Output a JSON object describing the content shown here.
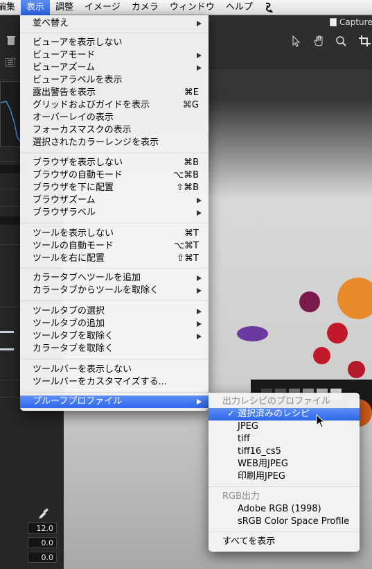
{
  "menubar": {
    "items": [
      "編集",
      "表示",
      "調整",
      "イメージ",
      "カメラ",
      "ウィンドウ",
      "ヘルプ"
    ],
    "active_index": 1
  },
  "window": {
    "title": "Capture"
  },
  "left_panel": {
    "values": [
      "12.0",
      "0.0",
      "0.0"
    ]
  },
  "view_menu": {
    "items": [
      {
        "label": "並べ替え",
        "shortcut": "",
        "submenu": true
      },
      {
        "label": "ビューアを表示しない",
        "shortcut": "",
        "submenu": false
      },
      {
        "label": "ビューアモード",
        "shortcut": "",
        "submenu": true
      },
      {
        "label": "ビューアズーム",
        "shortcut": "",
        "submenu": true
      },
      {
        "label": "ビューアラベルを表示",
        "shortcut": "",
        "submenu": false
      },
      {
        "label": "露出警告を表示",
        "shortcut": "⌘E",
        "submenu": false
      },
      {
        "label": "グリッドおよびガイドを表示",
        "shortcut": "⌘G",
        "submenu": false
      },
      {
        "label": "オーバーレイの表示",
        "shortcut": "",
        "submenu": false
      },
      {
        "label": "フォーカスマスクの表示",
        "shortcut": "",
        "submenu": false
      },
      {
        "label": "選択されたカラーレンジを表示",
        "shortcut": "",
        "submenu": false
      },
      {
        "label": "ブラウザを表示しない",
        "shortcut": "⌘B",
        "submenu": false
      },
      {
        "label": "ブラウザの自動モード",
        "shortcut": "⌥⌘B",
        "submenu": false
      },
      {
        "label": "ブラウザを下に配置",
        "shortcut": "⇧⌘B",
        "submenu": false
      },
      {
        "label": "ブラウザズーム",
        "shortcut": "",
        "submenu": true
      },
      {
        "label": "ブラウザラベル",
        "shortcut": "",
        "submenu": true
      },
      {
        "label": "ツールを表示しない",
        "shortcut": "⌘T",
        "submenu": false
      },
      {
        "label": "ツールの自動モード",
        "shortcut": "⌥⌘T",
        "submenu": false
      },
      {
        "label": "ツールを右に配置",
        "shortcut": "⇧⌘T",
        "submenu": false
      },
      {
        "label": "カラータブへツールを追加",
        "shortcut": "",
        "submenu": true
      },
      {
        "label": "カラータブからツールを取除く",
        "shortcut": "",
        "submenu": true
      },
      {
        "label": "ツールタブの選択",
        "shortcut": "",
        "submenu": true
      },
      {
        "label": "ツールタブの追加",
        "shortcut": "",
        "submenu": true
      },
      {
        "label": "ツールタブを取除く",
        "shortcut": "",
        "submenu": true
      },
      {
        "label": "カラータブを取除く",
        "shortcut": "",
        "submenu": false
      },
      {
        "label": "ツールバーを表示しない",
        "shortcut": "",
        "submenu": false
      },
      {
        "label": "ツールバーをカスタマイズする...",
        "shortcut": "",
        "submenu": false
      },
      {
        "label": "プルーフプロファイル",
        "shortcut": "",
        "submenu": true
      }
    ]
  },
  "proof_submenu": {
    "header_recipe": "出力レシピのプロファイル",
    "recipes": [
      "選択済みのレシピ",
      "JPEG",
      "tiff",
      "tiff16_cs5",
      "WEB用JPEG",
      "印刷用JPEG"
    ],
    "selected_recipe": "選択済みのレシピ",
    "header_rgb": "RGB出力",
    "rgb_profiles": [
      "Adobe RGB (1998)",
      "sRGB Color Space Profile"
    ],
    "show_all": "すべてを表示"
  }
}
